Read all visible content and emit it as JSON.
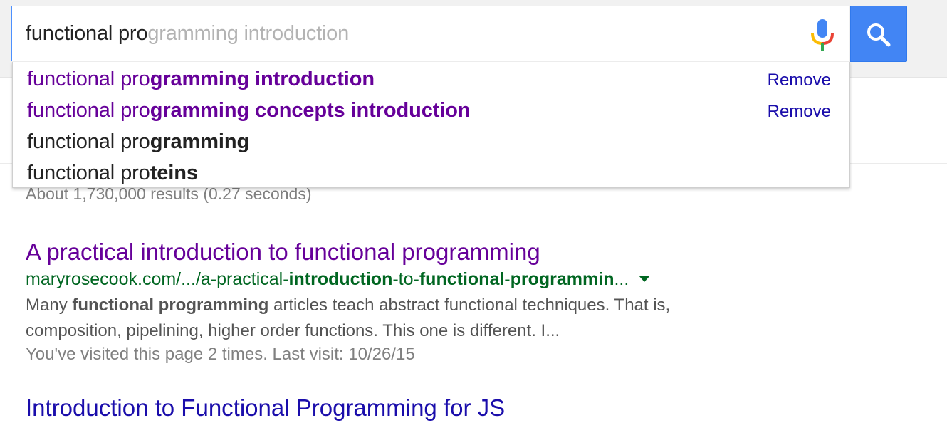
{
  "search": {
    "query_typed": "functional pro",
    "query_completion": "gramming introduction",
    "mic_icon": "microphone-icon",
    "search_icon": "magnifier-icon"
  },
  "suggestions": [
    {
      "base": "functional pro",
      "rest": "gramming introduction",
      "visited": true,
      "remove_label": "Remove"
    },
    {
      "base": "functional pro",
      "rest": "gramming concepts introduction",
      "visited": true,
      "remove_label": "Remove"
    },
    {
      "base": "functional pro",
      "rest": "gramming",
      "visited": false
    },
    {
      "base": "functional pro",
      "rest": "teins",
      "visited": false
    }
  ],
  "results": {
    "stats": "About 1,730,000 results (0.27 seconds)",
    "items": [
      {
        "title": "A practical introduction to functional programming",
        "url_parts": [
          "maryrosecook.com/.../a-practical-",
          "introduction",
          "-to-",
          "functional",
          "-",
          "programmin",
          "..."
        ],
        "snippet_parts": [
          "Many ",
          "functional programming",
          " articles teach abstract functional techniques. That is, composition, pipelining, higher order functions. This one is different. I..."
        ],
        "visited_note": "You've visited this page 2 times. Last visit: 10/26/15"
      }
    ],
    "next_title_partial": "Introduction to Functional Programming for JS"
  },
  "colors": {
    "visited_link": "#660099",
    "url_green": "#006621",
    "search_button": "#4285f4"
  }
}
